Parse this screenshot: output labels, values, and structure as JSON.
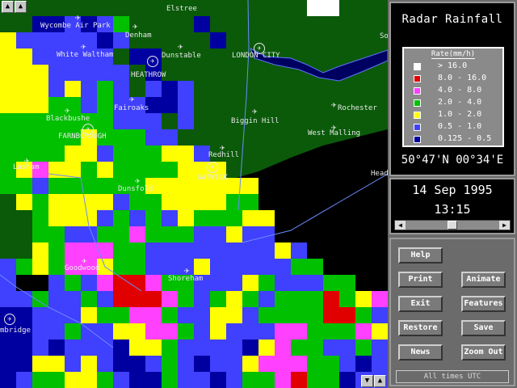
{
  "map": {
    "places": [
      {
        "name": "Elstree",
        "icon": "none"
      },
      {
        "name": "Wycombe Air Park",
        "icon": "plane"
      },
      {
        "name": "Denham",
        "icon": "plane"
      },
      {
        "name": "White Waltham",
        "icon": "plane"
      },
      {
        "name": "Dunstable",
        "icon": "plane"
      },
      {
        "name": "HEATHROW",
        "icon": "plane-ring"
      },
      {
        "name": "LONDON CITY",
        "icon": "plane-ring"
      },
      {
        "name": "Fairoaks",
        "icon": "plane"
      },
      {
        "name": "Blackbushe",
        "icon": "plane"
      },
      {
        "name": "FARNBOROUGH",
        "icon": "plane-ring"
      },
      {
        "name": "Biggin Hill",
        "icon": "plane"
      },
      {
        "name": "Rochester",
        "icon": "plane"
      },
      {
        "name": "West Malling",
        "icon": "plane"
      },
      {
        "name": "Redhill",
        "icon": "plane"
      },
      {
        "name": "GATWICK",
        "icon": "plane-ring"
      },
      {
        "name": "Lasham",
        "icon": "plane"
      },
      {
        "name": "Dunsfold",
        "icon": "plane"
      },
      {
        "name": "Goodwood",
        "icon": "plane"
      },
      {
        "name": "Shoreham",
        "icon": "plane"
      },
      {
        "name": "mbridge",
        "icon": "plane-ring"
      },
      {
        "name": "Head",
        "icon": "none"
      },
      {
        "name": "So",
        "icon": "none"
      }
    ],
    "scroll_buttons": [
      "up-left",
      "up-right",
      "down",
      "up"
    ]
  },
  "panel": {
    "title": "Radar Rainfall",
    "legend": {
      "title": "Rate(mm/h)",
      "rows": [
        {
          "label": "> 16.0",
          "color": "#ffffff"
        },
        {
          "label": "8.0 - 16.0",
          "color": "#e00000"
        },
        {
          "label": "4.0 - 8.0",
          "color": "#ff40ff"
        },
        {
          "label": "2.0 - 4.0",
          "color": "#00c000"
        },
        {
          "label": "1.0 - 2.0",
          "color": "#ffff00"
        },
        {
          "label": "0.5 - 1.0",
          "color": "#4040ff"
        },
        {
          "label": "0.125 - 0.5",
          "color": "#0000a0"
        }
      ]
    },
    "coords": "50°47'N 00°34'E",
    "date": "14 Sep 1995",
    "time": "13:15",
    "slider_position": 0.5,
    "buttons": {
      "help": "Help",
      "print": "Print",
      "animate": "Animate",
      "exit": "Exit",
      "features": "Features",
      "restore": "Restore",
      "save": "Save",
      "news": "News",
      "zoom_out": "Zoom Out"
    },
    "footer": "All times UTC"
  },
  "colors": {
    "land": "#0a5a0a",
    "sea": "#000000",
    "panel_bg": "#6b6b6b"
  }
}
